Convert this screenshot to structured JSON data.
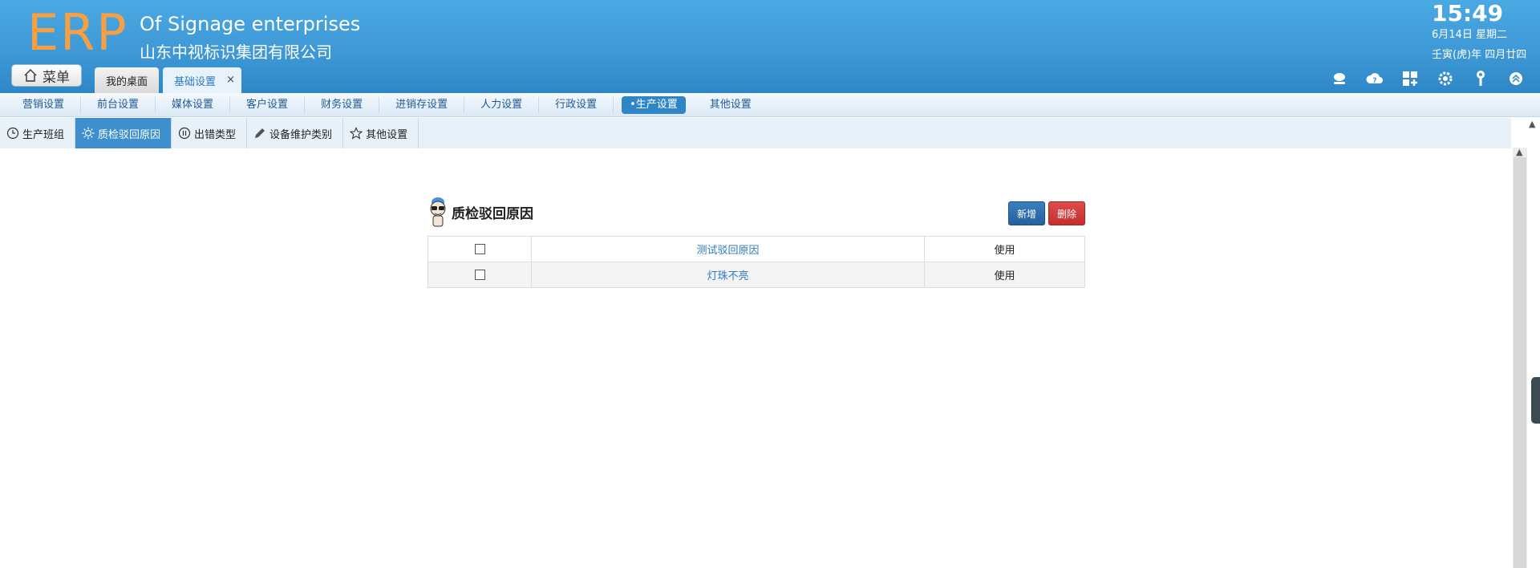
{
  "header": {
    "logo": "ERP",
    "company_en": "Of Signage enterprises",
    "company_cn": "山东中视标识集团有限公司",
    "time": "15:49",
    "date": "6月14日 星期二",
    "lunar": "壬寅(虎)年 四月廿四"
  },
  "menu_button": {
    "label": "菜单"
  },
  "tabs": [
    {
      "label": "我的桌面"
    },
    {
      "label": "基础设置",
      "close": "×"
    }
  ],
  "top_icons": [
    "user-icon",
    "cloud-help-icon",
    "apps-add-icon",
    "gear-icon",
    "key-icon",
    "collapse-up-icon"
  ],
  "module_nav": [
    {
      "label": "营销设置"
    },
    {
      "label": "前台设置"
    },
    {
      "label": "媒体设置"
    },
    {
      "label": "客户设置"
    },
    {
      "label": "财务设置"
    },
    {
      "label": "进销存设置"
    },
    {
      "label": "人力设置"
    },
    {
      "label": "行政设置"
    },
    {
      "label": "•生产设置",
      "active": true
    },
    {
      "label": "其他设置"
    }
  ],
  "sub_nav": [
    {
      "label": "生产班组",
      "icon": "clock-icon"
    },
    {
      "label": "质检驳回原因",
      "icon": "sun-icon",
      "active": true
    },
    {
      "label": "出错类型",
      "icon": "pause-circle-icon"
    },
    {
      "label": "设备维护类别",
      "icon": "pencil-icon"
    },
    {
      "label": "其他设置",
      "icon": "star-icon"
    }
  ],
  "panel": {
    "title": "质检驳回原因",
    "add_label": "新增",
    "delete_label": "删除",
    "rows": [
      {
        "name": "测试驳回原因",
        "status": "使用"
      },
      {
        "name": "灯珠不亮",
        "status": "使用"
      }
    ]
  },
  "colors": {
    "header": "#3d97d5",
    "logo": "#f6a043",
    "active": "#2f86c6",
    "delete": "#c42e2e"
  }
}
